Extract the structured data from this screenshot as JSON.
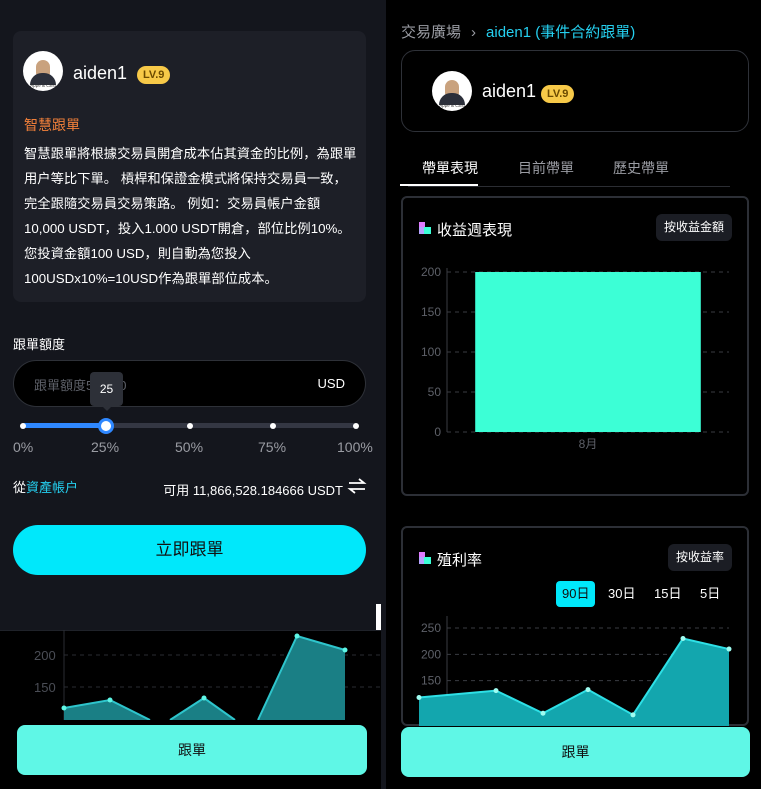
{
  "trader": {
    "name": "aiden1",
    "level": "LV.9"
  },
  "left": {
    "intro_title": "智慧跟單",
    "intro_text": "智慧跟單將根據交易員開倉成本佔其資金的比例，為跟單用户等比下單。 槓桿和保證金模式將保持交易員一致，完全跟隨交易員交易策路。 例如：交易員帳户金額10,000 USDT，投入1.000 USDT開倉，部位比例10%。 您投資金額100 USD，則自動為您投入100USDx10%=10USD作為跟單部位成本。",
    "amount_label": "跟單額度",
    "amount_placeholder": "跟單額度5-1000",
    "amount_unit": "USD",
    "slider_tooltip": "25",
    "slider_percent": 25,
    "ticks": [
      "0%",
      "25%",
      "50%",
      "75%",
      "100%"
    ],
    "from_prefix": "從",
    "from_link": "資產帳户",
    "available": "可用 11,866,528.184666 USDT",
    "follow_now": "立即跟單",
    "follow": "跟單",
    "mini_chart_ticks": [
      "200",
      "150"
    ]
  },
  "right": {
    "breadcrumb": {
      "parent": "交易廣場",
      "current": "aiden1 (事件合約跟單)"
    },
    "tabs": [
      "帶單表現",
      "目前帶單",
      "歷史帶單"
    ],
    "weekly_card": {
      "title": "收益週表現",
      "button": "按收益金額"
    },
    "winrate_card": {
      "title": "殖利率",
      "button": "按收益率",
      "ranges": [
        "90日",
        "30日",
        "15日",
        "5日"
      ],
      "active_range": "90日"
    },
    "follow": "跟單"
  },
  "colors": {
    "accent": "#00e8fb",
    "teal": "#3cffd6",
    "follow_btn": "#5ff7e6",
    "level_badge": "#f7c948",
    "orange": "#f2803a",
    "link": "#25d0f0",
    "slider": "#2f88ff"
  },
  "chart_data": [
    {
      "type": "bar",
      "title": "收益週表現",
      "categories": [
        "8月"
      ],
      "values": [
        200
      ],
      "yticks": [
        0,
        50,
        100,
        150,
        200
      ],
      "ylim": [
        0,
        200
      ],
      "grid": true
    },
    {
      "type": "area",
      "title": "殖利率",
      "x": [
        1,
        2,
        3,
        4,
        5,
        6,
        7
      ],
      "values": [
        118,
        131,
        88,
        133,
        85,
        230,
        210
      ],
      "yticks": [
        150,
        200,
        250
      ],
      "ylim": [
        110,
        250
      ],
      "grid": true
    }
  ]
}
